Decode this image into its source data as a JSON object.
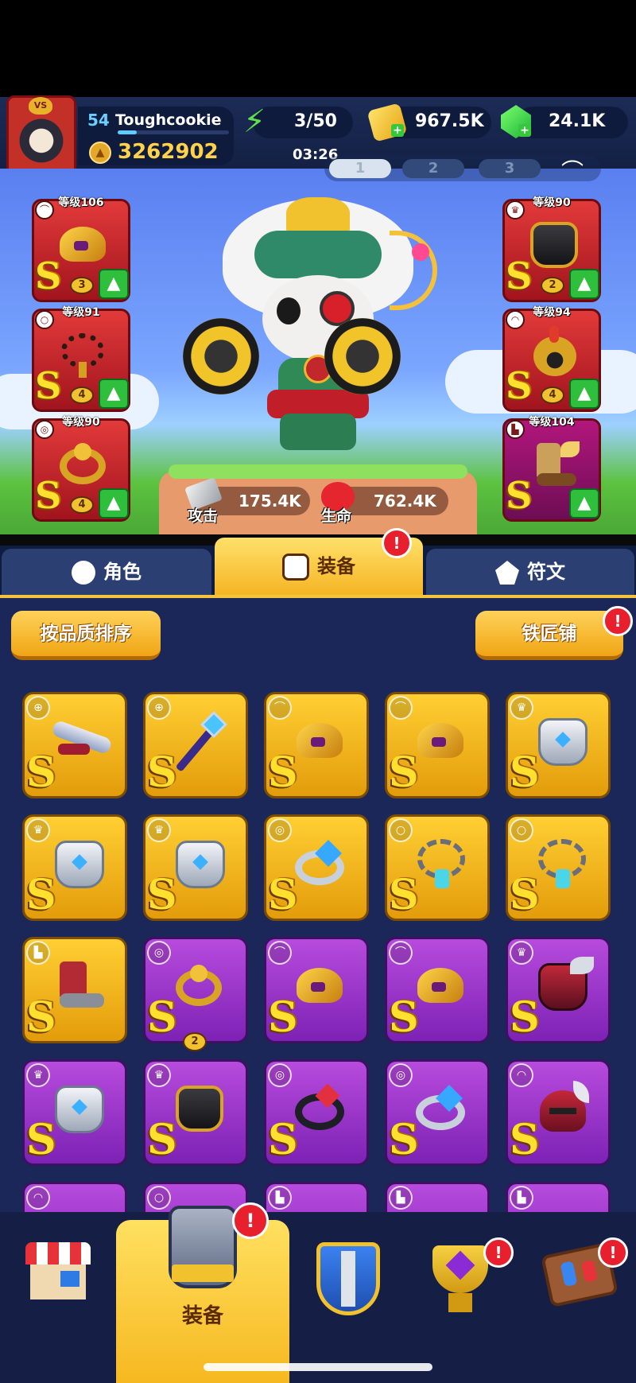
{
  "player": {
    "level": "54",
    "name": "Toughcookie",
    "xp_fraction": 0.17,
    "power": "3262902",
    "avatar_badge": "VS"
  },
  "resources": {
    "energy": "3/50",
    "energy_timer": "03:26",
    "gold": "967.5K",
    "gems": "24.1K"
  },
  "loadout_tabs": [
    "1",
    "2",
    "3"
  ],
  "equipped_left": [
    {
      "level": "等级106",
      "stars": "3",
      "item": "golden-winged-helmet"
    },
    {
      "level": "等级91",
      "stars": "4",
      "item": "bead-necklace"
    },
    {
      "level": "等级90",
      "stars": "4",
      "item": "lion-ring"
    }
  ],
  "equipped_right": [
    {
      "level": "等级90",
      "stars": "2",
      "item": "black-gold-armor"
    },
    {
      "level": "等级94",
      "stars": "4",
      "item": "gladiator-helmet"
    },
    {
      "level": "等级104",
      "stars": "",
      "item": "winged-boot"
    }
  ],
  "stats": {
    "attack_label": "攻击",
    "attack": "175.4K",
    "hp_label": "生命",
    "hp": "762.4K"
  },
  "tabs": {
    "role": "角色",
    "equip": "装备",
    "rune": "符文",
    "equip_badge": "!"
  },
  "actions": {
    "sort": "按品质排序",
    "smith": "铁匠铺",
    "smith_badge": "!"
  },
  "inventory": [
    {
      "rarity": "gold",
      "grade": "S",
      "item": "winged-crossbow",
      "stars": ""
    },
    {
      "rarity": "gold",
      "grade": "S",
      "item": "crystal-staff",
      "stars": ""
    },
    {
      "rarity": "gold",
      "grade": "S",
      "item": "golden-winged-helmet",
      "stars": ""
    },
    {
      "rarity": "gold",
      "grade": "S",
      "item": "golden-winged-helmet",
      "stars": ""
    },
    {
      "rarity": "gold",
      "grade": "S",
      "item": "silver-armor",
      "stars": ""
    },
    {
      "rarity": "gold",
      "grade": "S",
      "item": "silver-armor",
      "stars": ""
    },
    {
      "rarity": "gold",
      "grade": "S",
      "item": "silver-armor",
      "stars": ""
    },
    {
      "rarity": "gold",
      "grade": "S",
      "item": "sapphire-ring",
      "stars": ""
    },
    {
      "rarity": "gold",
      "grade": "S",
      "item": "chain-amulet",
      "stars": ""
    },
    {
      "rarity": "gold",
      "grade": "S",
      "item": "chain-amulet",
      "stars": ""
    },
    {
      "rarity": "gold",
      "grade": "S",
      "item": "red-boot",
      "stars": ""
    },
    {
      "rarity": "purple",
      "grade": "S",
      "item": "lion-ring",
      "stars": "2"
    },
    {
      "rarity": "purple",
      "grade": "S",
      "item": "golden-winged-helmet",
      "stars": ""
    },
    {
      "rarity": "purple",
      "grade": "S",
      "item": "golden-winged-helmet",
      "stars": ""
    },
    {
      "rarity": "purple",
      "grade": "S",
      "item": "red-winged-armor",
      "stars": ""
    },
    {
      "rarity": "purple",
      "grade": "S",
      "item": "silver-armor",
      "stars": ""
    },
    {
      "rarity": "purple",
      "grade": "S",
      "item": "black-gold-armor",
      "stars": ""
    },
    {
      "rarity": "purple",
      "grade": "S",
      "item": "ruby-ring",
      "stars": ""
    },
    {
      "rarity": "purple",
      "grade": "S",
      "item": "sapphire-ring",
      "stars": ""
    },
    {
      "rarity": "purple",
      "grade": "S",
      "item": "horned-helmet",
      "stars": ""
    },
    {
      "rarity": "purple",
      "grade": "",
      "item": "helmet",
      "stars": ""
    },
    {
      "rarity": "purple",
      "grade": "",
      "item": "amulet",
      "stars": ""
    },
    {
      "rarity": "purple",
      "grade": "",
      "item": "boot",
      "stars": ""
    },
    {
      "rarity": "purple",
      "grade": "",
      "item": "boot",
      "stars": ""
    },
    {
      "rarity": "purple",
      "grade": "",
      "item": "boot",
      "stars": ""
    }
  ],
  "bottom_nav": {
    "equip_label": "装备",
    "badge": "!"
  },
  "colors": {
    "gold_rarity": "#f4b31c",
    "purple_rarity": "#9b34cc",
    "red_slot": "#c9242c",
    "accent_yellow": "#f5b524",
    "panel_navy": "#1b2758"
  }
}
